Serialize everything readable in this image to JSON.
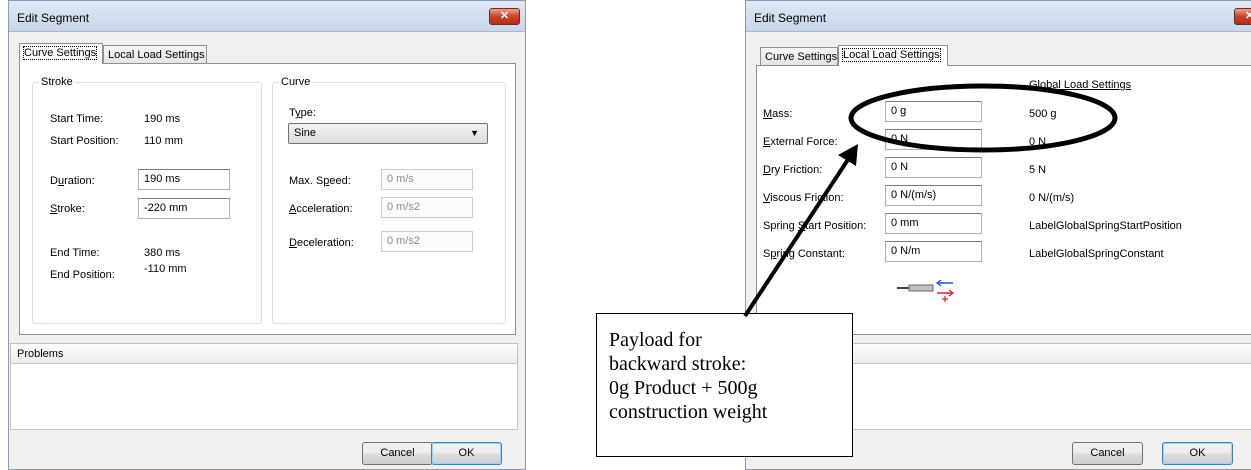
{
  "left_dialog": {
    "title": "Edit Segment",
    "close": "✕",
    "tabs": [
      "Curve Settings",
      "Local Load Settings"
    ],
    "stroke_group": {
      "label": "Stroke",
      "start_time_label": "Start Time:",
      "start_time": "190 ms",
      "start_position_label": "Start Position:",
      "start_position": "110 mm",
      "duration_label": "Duration:",
      "duration": "190 ms",
      "stroke_label": "Stroke:",
      "stroke": "-220 mm",
      "end_time_label": "End Time:",
      "end_time": "380 ms",
      "end_position_label": "End Position:",
      "end_position": "-110 mm"
    },
    "curve_group": {
      "label": "Curve",
      "type_label": "Type:",
      "type_value": "Sine",
      "max_speed_label": "Max. Speed:",
      "max_speed": "0 m/s",
      "acceleration_label": "Acceleration:",
      "acceleration": "0 m/s2",
      "deceleration_label": "Deceleration:",
      "deceleration": "0 m/s2"
    },
    "problems_label": "Problems",
    "cancel": "Cancel",
    "ok": "OK"
  },
  "right_dialog": {
    "title": "Edit Segment",
    "close": "✕",
    "tabs": [
      "Curve Settings",
      "Local Load Settings"
    ],
    "global_header": "Global Load Settings",
    "rows": [
      {
        "label": "Mass:",
        "value": "0 g",
        "global": "500 g"
      },
      {
        "label": "External Force:",
        "value": "0 N",
        "global": "0 N"
      },
      {
        "label": "Dry Friction:",
        "value": "0 N",
        "global": "5 N"
      },
      {
        "label": "Viscous Friction:",
        "value": "0 N/(m/s)",
        "global": "0 N/(m/s)"
      },
      {
        "label": "Spring Start Position:",
        "value": "0 mm",
        "global": "LabelGlobalSpringStartPosition"
      },
      {
        "label": "Spring Constant:",
        "value": "0 N/m",
        "global": "LabelGlobalSpringConstant"
      }
    ],
    "cancel": "Cancel",
    "ok": "OK"
  },
  "callout": {
    "lines": [
      "Payload for",
      "backward stroke:",
      "0g Product + 500g",
      "construction weight"
    ]
  },
  "icons": {
    "close": "close-icon",
    "dropdown": "chevron-down-icon",
    "spring": "spring-icon"
  }
}
